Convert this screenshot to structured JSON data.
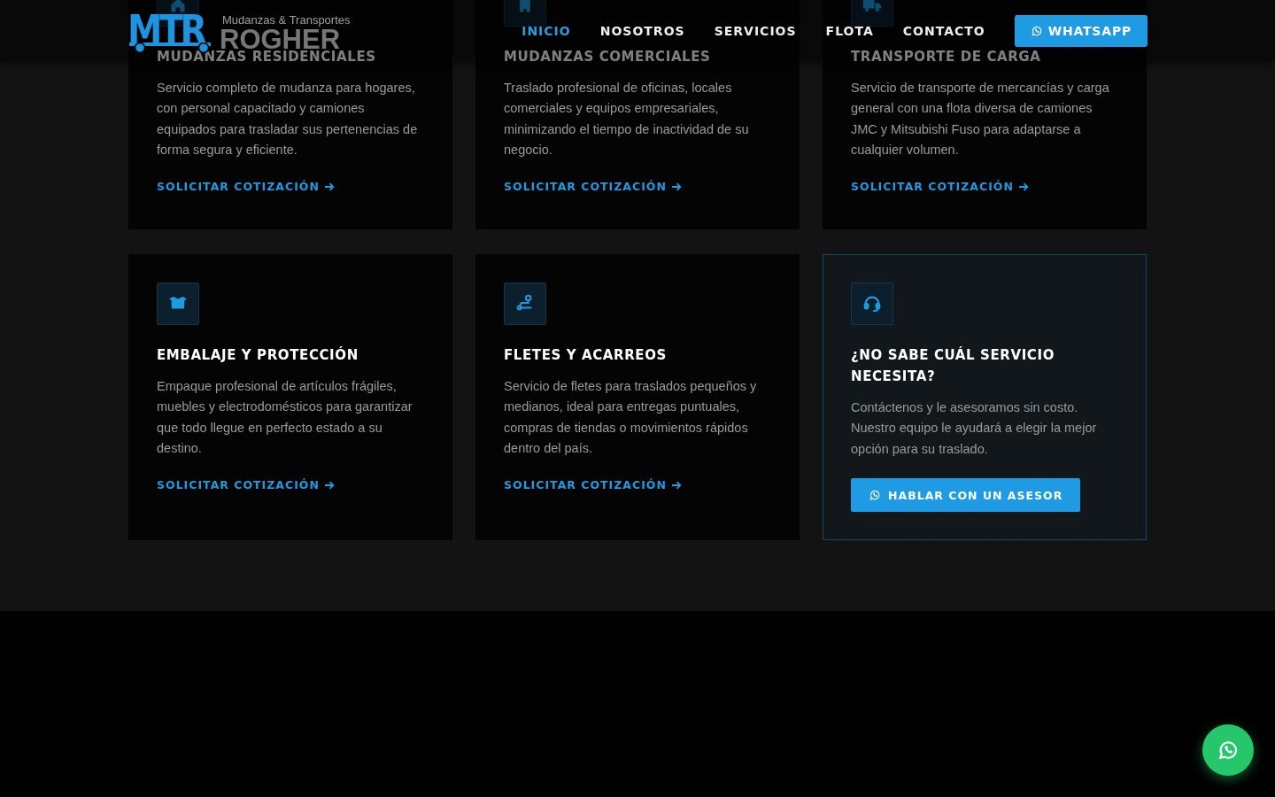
{
  "header": {
    "logo": {
      "mark": "MTR",
      "tagline": "Mudanzas & Transportes",
      "name": "ROGHER"
    },
    "nav": [
      {
        "label": "INICIO",
        "selected": true
      },
      {
        "label": "NOSOTROS",
        "selected": false
      },
      {
        "label": "SERVICIOS",
        "selected": false
      },
      {
        "label": "FLOTA",
        "selected": false
      },
      {
        "label": "CONTACTO",
        "selected": false
      }
    ],
    "cta": "WHATSAPP"
  },
  "cards": [
    {
      "kind": "service",
      "title": "MUDANZAS RESIDENCIALES",
      "text": "Servicio completo de mudanza para hogares, con personal capacitado y camiones equipados para trasladar sus pertenencias de forma segura y eficiente.",
      "action": "SOLICITAR COTIZACIÓN"
    },
    {
      "kind": "service",
      "title": "MUDANZAS COMERCIALES",
      "text": "Traslado profesional de oficinas, locales comerciales y equipos empresariales, minimizando el tiempo de inactividad de su negocio.",
      "action": "SOLICITAR COTIZACIÓN"
    },
    {
      "kind": "service",
      "title": "TRANSPORTE DE CARGA",
      "text": "Servicio de transporte de mercancías y carga general con una flota diversa de camiones JMC y Mitsubishi Fuso para adaptarse a cualquier volumen.",
      "action": "SOLICITAR COTIZACIÓN"
    },
    {
      "kind": "service",
      "title": "EMBALAJE Y PROTECCIÓN",
      "text": "Empaque profesional de artículos frágiles, muebles y electrodomésticos para garantizar que todo llegue en perfecto estado a su destino.",
      "action": "SOLICITAR COTIZACIÓN"
    },
    {
      "kind": "service",
      "title": "FLETES Y ACARREOS",
      "text": "Servicio de fletes para traslados pequeños y medianos, ideal para entregas puntuales, compras de tiendas o movimientos rápidos dentro del país.",
      "action": "SOLICITAR COTIZACIÓN"
    },
    {
      "kind": "cta",
      "title": "¿NO SABE CUÁL SERVICIO NECESITA?",
      "text": "Contáctenos y le asesoramos sin costo. Nuestro equipo le ayudará a elegir la mejor opción para su traslado.",
      "action": "HABLAR CON UN ASESOR"
    }
  ]
}
